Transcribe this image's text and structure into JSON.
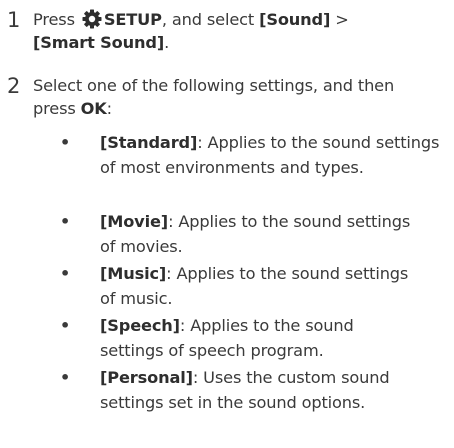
{
  "steps": [
    {
      "number": "1",
      "press_prefix": "Press ",
      "icon": "gear-icon",
      "setup_label": "SETUP",
      "text_mid": ", and select ",
      "sound_label": "[Sound]",
      "separator": " >",
      "smart_sound_label": "[Smart Sound]",
      "text_end": "."
    },
    {
      "number": "2",
      "text_start": "Select one of the following settings, and then press ",
      "ok_label": "OK",
      "text_end": ":"
    }
  ],
  "options": [
    {
      "bullet": "•",
      "label": "[Standard]",
      "description": ": Applies to the sound settings of most environments and types."
    },
    {
      "bullet": "•",
      "label": "[Movie]",
      "description": ": Applies to the sound settings of movies."
    },
    {
      "bullet": "•",
      "label": "[Music]",
      "description": ": Applies to the sound settings of music."
    },
    {
      "bullet": "•",
      "label": "[Speech]",
      "description": ": Applies to the sound settings of speech program."
    },
    {
      "bullet": "•",
      "label": "[Personal]",
      "description": ": Uses the custom sound settings set in the sound options."
    }
  ]
}
